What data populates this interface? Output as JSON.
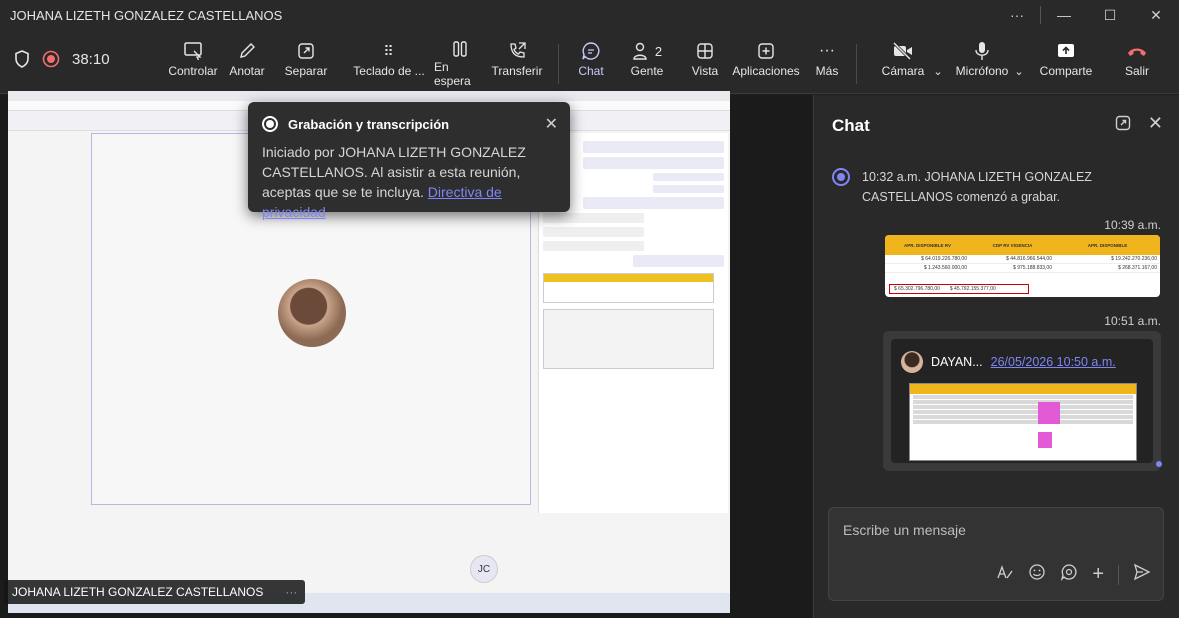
{
  "window": {
    "title": "JOHANA LIZETH GONZALEZ CASTELLANOS",
    "controls": {
      "more": "···",
      "minimize": "—",
      "maximize": "☐",
      "close": "✕"
    }
  },
  "toolbar": {
    "timer": "38:10",
    "buttons": {
      "controlar": "Controlar",
      "anotar": "Anotar",
      "separar": "Separar",
      "teclado": "Teclado de ...",
      "espera": "En espera",
      "transferir": "Transferir",
      "chat": "Chat",
      "gente": "Gente",
      "gente_count": "2",
      "vista": "Vista",
      "aplicaciones": "Aplicaciones",
      "mas": "Más",
      "camara": "Cámara",
      "microfono": "Micrófono",
      "comparte": "Comparte",
      "salir": "Salir"
    }
  },
  "popup": {
    "title": "Grabación y transcripción",
    "body": "Iniciado por JOHANA LIZETH GONZALEZ CASTELLANOS. Al asistir a esta reunión, aceptas que se te incluya.",
    "link": "Directiva de privacidad"
  },
  "stage": {
    "presenter_name": "JOHANA LIZETH GONZALEZ CASTELLANOS",
    "initials": "JC"
  },
  "chat": {
    "title": "Chat",
    "system_message": "10:32 a.m.   JOHANA LIZETH GONZALEZ CASTELLANOS comenzó a grabar.",
    "time1": "10:39 a.m.",
    "time2": "10:51 a.m.",
    "image_table": {
      "headers": [
        "APR. DISPONIBLE RV",
        "CDP RV VIGENCIA",
        "APR. DISPONIBLE"
      ],
      "rows": [
        [
          "$ 64.019.226.780,00",
          "$ 44.816.966.544,00",
          "$ 19.242.270.236,00"
        ],
        [
          "$ 1.243.560.000,00",
          "$ 975.188.833,00",
          "$ 268.371.167,00"
        ]
      ],
      "total": [
        "$    65.302.796.780,00",
        "$    45.792.155.377,00"
      ]
    },
    "card": {
      "name": "DAYAN...",
      "link": "26/05/2026 10:50 a.m."
    },
    "composer_placeholder": "Escribe un mensaje"
  },
  "colors": {
    "accent": "#7f85f5",
    "recording": "#f36d6d",
    "background": "#1f1f1f",
    "panel": "#292929"
  }
}
